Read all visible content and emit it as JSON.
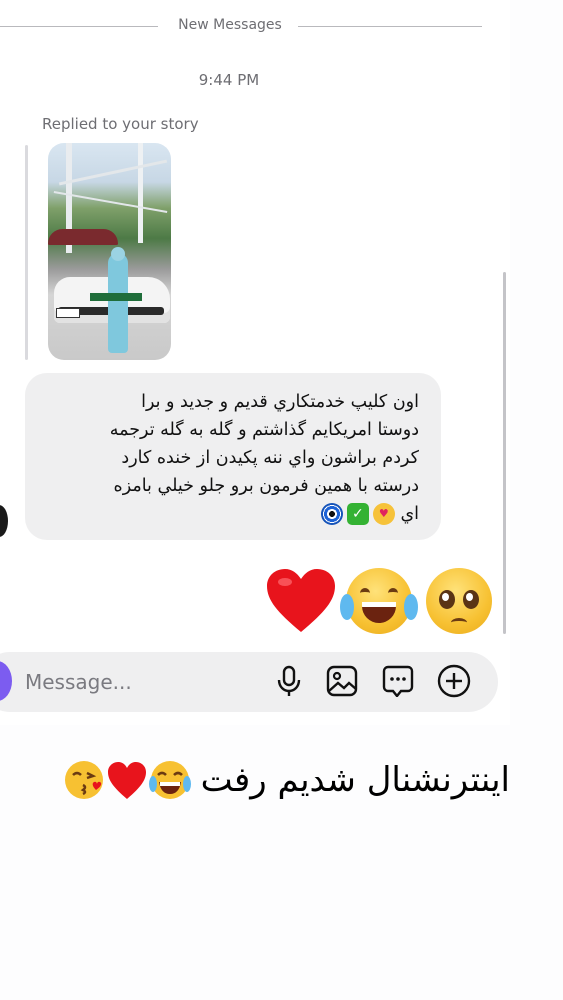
{
  "divider": {
    "label": "New Messages"
  },
  "timestamp": "9:44 PM",
  "reply": {
    "label": "Replied to your story"
  },
  "message": {
    "lines": [
      "اون کليپ خدمتکاري قديم و جديد و برا",
      "دوستا امريکايم گذاشتم و گله به گله ترجمه",
      "کردم براشون واي ننه پکيدن از خنده کارد",
      "درسته با همين فرمون برو جلو خيلي بامزه",
      "اي"
    ],
    "emojis": [
      "heart-eyes",
      "check-mark",
      "nazar-amulet"
    ]
  },
  "reactions": [
    "red-heart",
    "tears-of-joy",
    "pleading-face"
  ],
  "composer": {
    "placeholder": "Message..."
  },
  "composer_icons": [
    "microphone-icon",
    "gallery-icon",
    "sticker-icon",
    "plus-icon"
  ],
  "caption": {
    "text": "اينترنشنال شديم رفت",
    "emojis": [
      "kiss-heart",
      "red-heart",
      "tears-of-joy"
    ]
  },
  "colors": {
    "bubble": "#efeff0",
    "accent": "#7c5cf0",
    "heart": "#e8141c",
    "check": "#34b233"
  }
}
